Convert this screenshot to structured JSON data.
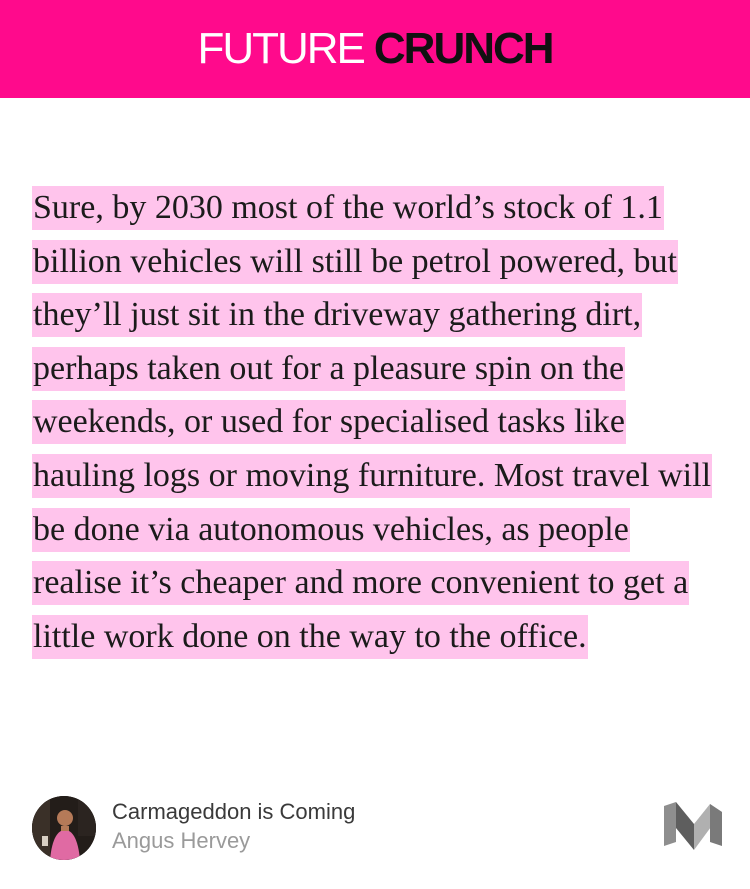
{
  "header": {
    "brand_first": "FUTURE",
    "brand_second": "CRUNCH",
    "background_color": "#ff0a8c"
  },
  "quote": {
    "text": "Sure, by 2030 most of the world’s stock of 1.1 billion vehicles will still be petrol powered, but they’ll just sit in the driveway gathering dirt, perhaps taken out for a pleasure spin on the weekends, or used for specialised tasks like hauling logs or moving furniture. Most travel will be done via autonomous vehicles, as people realise it’s cheaper and more convenient to get a little work done on the way to the office.",
    "highlight_color": "#ffc4ec"
  },
  "footer": {
    "article_title": "Carmageddon is Coming",
    "author": "Angus Hervey",
    "avatar_icon": "author-avatar",
    "logo_icon": "medium-logo-icon"
  }
}
